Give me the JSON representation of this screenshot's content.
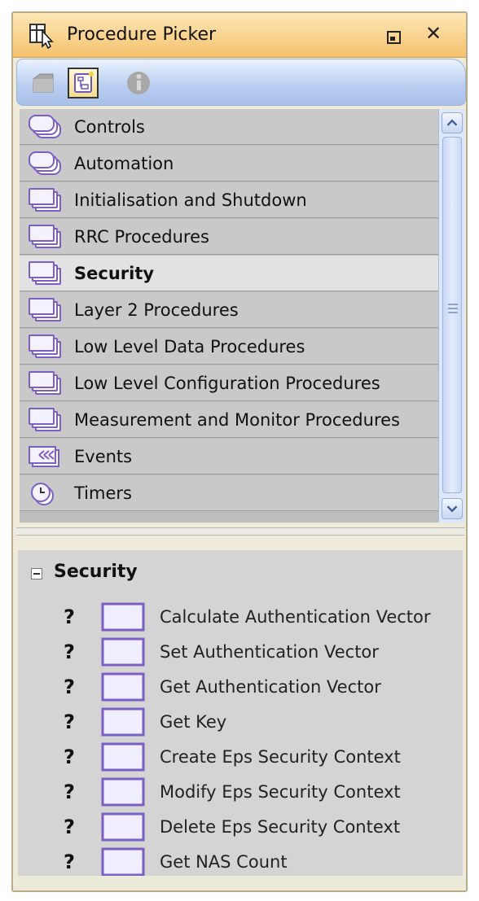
{
  "window": {
    "title": "Procedure Picker",
    "title_icon": "picker-cursor-icon",
    "controls": {
      "restore_icon": "restore-icon",
      "close_glyph": "✕"
    }
  },
  "toolbar": {
    "buttons": [
      {
        "icon": "folder-icon",
        "state": "disabled"
      },
      {
        "icon": "procedure-tree-icon",
        "state": "selected"
      },
      {
        "icon": "info-icon",
        "state": "disabled"
      }
    ]
  },
  "categories": [
    {
      "label": "Controls",
      "icon": "stack-rounded-icon",
      "selected": false
    },
    {
      "label": "Automation",
      "icon": "stack-rounded-icon",
      "selected": false
    },
    {
      "label": "Initialisation and Shutdown",
      "icon": "stack-icon",
      "selected": false
    },
    {
      "label": "RRC Procedures",
      "icon": "stack-icon",
      "selected": false
    },
    {
      "label": "Security",
      "icon": "stack-icon",
      "selected": true
    },
    {
      "label": "Layer 2 Procedures",
      "icon": "stack-icon",
      "selected": false
    },
    {
      "label": "Low Level Data Procedures",
      "icon": "stack-icon",
      "selected": false
    },
    {
      "label": "Low Level Configuration Procedures",
      "icon": "stack-icon",
      "selected": false
    },
    {
      "label": "Measurement and Monitor Procedures",
      "icon": "stack-icon",
      "selected": false
    },
    {
      "label": "Events",
      "icon": "events-icon",
      "selected": false
    },
    {
      "label": "Timers",
      "icon": "timer-icon",
      "selected": false
    }
  ],
  "detail": {
    "title": "Security",
    "expander": "⊟",
    "unknown_glyph": "?",
    "procedures": [
      "Calculate Authentication Vector",
      "Set Authentication Vector",
      "Get Authentication Vector",
      "Get Key",
      "Create Eps Security Context",
      "Modify Eps Security Context",
      "Delete Eps Security Context",
      "Get NAS Count"
    ]
  },
  "colors": {
    "title_bar": "#f5c26e",
    "toolbar": "#b8cdf0",
    "list_row": "#c9c9c9",
    "list_row_selected": "#e2e2e2",
    "procedure_box": "#7b5fc4"
  }
}
